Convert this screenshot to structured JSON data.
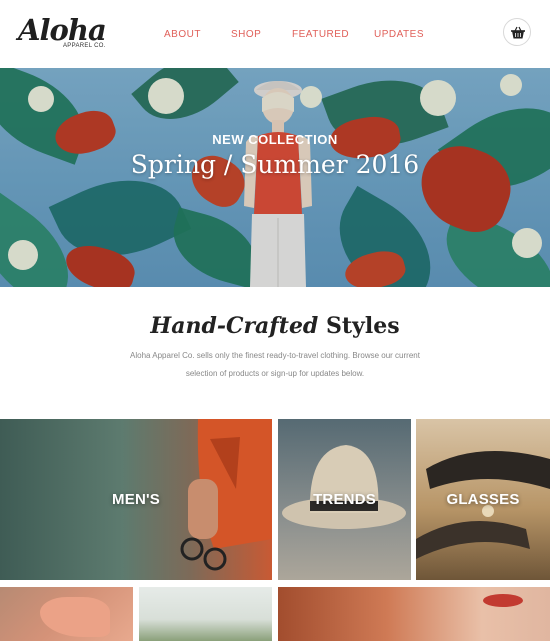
{
  "header": {
    "logo_script": "Aloha",
    "logo_sub": "APPAREL CO.",
    "nav": [
      {
        "label": "ABOUT"
      },
      {
        "label": "SHOP"
      },
      {
        "label": "FEATURED"
      },
      {
        "label": "UPDATES"
      }
    ],
    "cart_icon": "basket-icon"
  },
  "hero": {
    "eyebrow": "NEW COLLECTION",
    "title": "Spring / Summer 2016"
  },
  "intro": {
    "heading_italic": "Hand-Crafted",
    "heading_bold": "Styles",
    "text": "Aloha Apparel Co. sells only the finest ready-to-travel clothing. Browse our current selection of products or sign-up for updates below."
  },
  "tiles": [
    {
      "label": "MEN'S"
    },
    {
      "label": "TRENDS"
    },
    {
      "label": "GLASSES"
    }
  ],
  "colors": {
    "accent": "#e0605a",
    "text_dark": "#222222",
    "text_muted": "#888888"
  }
}
